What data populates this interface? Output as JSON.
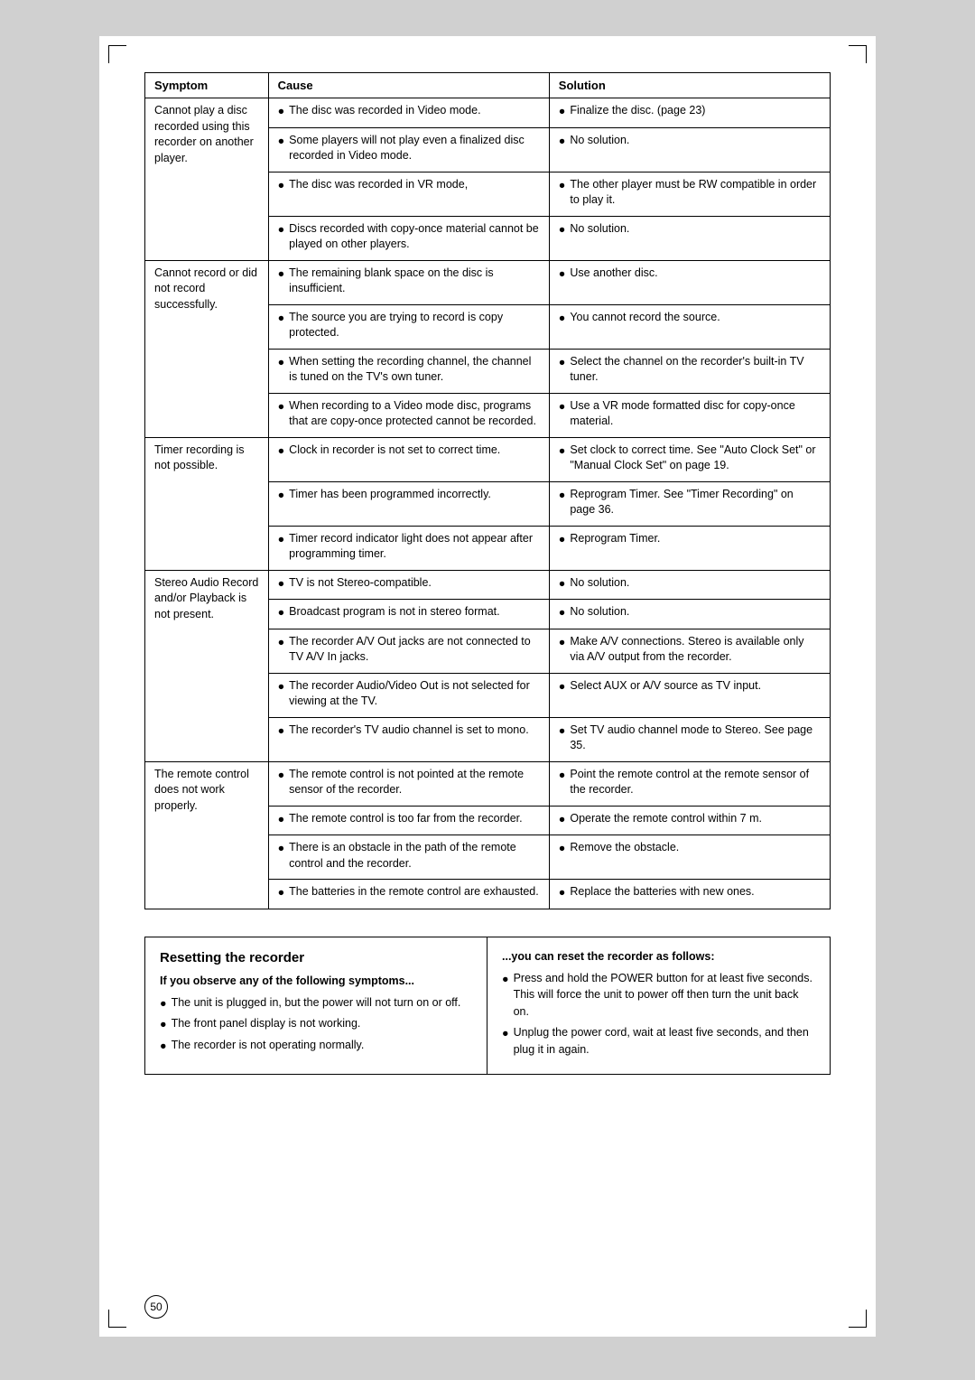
{
  "page": {
    "number": "50",
    "table": {
      "headers": [
        "Symptom",
        "Cause",
        "Solution"
      ],
      "rows": [
        {
          "symptom": "Cannot play a disc recorded using this recorder on another player.",
          "causes": [
            "The disc was recorded in Video mode.",
            "Some players will not play even a finalized disc recorded in Video mode.",
            "The disc was recorded in VR mode,",
            "Discs recorded with copy-once material cannot be played on other players."
          ],
          "solutions": [
            "Finalize the disc. (page 23)",
            "No solution.",
            "The other player must be RW compatible in order to play it.",
            "No solution."
          ]
        },
        {
          "symptom": "Cannot record or did not record successfully.",
          "causes": [
            "The remaining blank space on the disc is insufficient.",
            "The source you are trying to record is copy protected.",
            "When setting the recording channel, the channel is tuned on the TV's own tuner.",
            "When recording to a Video mode disc, programs that are copy-once protected cannot be recorded."
          ],
          "solutions": [
            "Use another disc.",
            "You cannot record the source.",
            "Select the channel on the recorder's built-in TV tuner.",
            "Use a VR mode formatted disc for copy-once material."
          ]
        },
        {
          "symptom": "Timer recording is not possible.",
          "causes": [
            "Clock in recorder is not set to correct time.",
            "Timer has been programmed incorrectly.",
            "Timer record indicator light does not appear after programming timer."
          ],
          "solutions": [
            "Set clock to correct time. See \"Auto Clock Set\" or \"Manual Clock Set\" on page 19.",
            "Reprogram Timer. See \"Timer Recording\" on page 36.",
            "Reprogram Timer."
          ]
        },
        {
          "symptom": "Stereo Audio Record and/or Playback is not present.",
          "causes": [
            "TV is not Stereo-compatible.",
            "Broadcast program is not in stereo format.",
            "The recorder A/V Out jacks are not connected to TV A/V In jacks.",
            "The recorder Audio/Video Out is not selected for viewing at the TV.",
            "The recorder's TV audio channel is set to mono."
          ],
          "solutions": [
            "No solution.",
            "No solution.",
            "Make A/V connections. Stereo is available only via A/V output from the recorder.",
            "Select AUX or A/V source as TV input.",
            "Set TV audio channel mode to Stereo. See page 35."
          ]
        },
        {
          "symptom": "The remote control does not work properly.",
          "causes": [
            "The remote control is not pointed at the remote sensor of the recorder.",
            "The remote control is too far from the recorder.",
            "There is an obstacle in the path of the remote control and the recorder.",
            "The batteries in the remote control are exhausted."
          ],
          "solutions": [
            "Point the remote control at the remote sensor of the recorder.",
            "Operate the remote control within 7 m.",
            "Remove the obstacle.",
            "Replace the batteries with new ones."
          ]
        }
      ]
    },
    "reset": {
      "title": "Resetting the recorder",
      "left_subtitle": "If you observe any of the following symptoms...",
      "left_bullets": [
        "The unit is plugged in, but the power will not turn on or off.",
        "The front panel display is not working.",
        "The recorder is not operating normally."
      ],
      "right_subtitle": "...you can reset the recorder as follows:",
      "right_bullets": [
        "Press and hold the POWER button for at least five seconds. This will force the unit to power off then turn the unit back on.",
        "Unplug the power cord, wait at least five seconds, and then plug it in again."
      ]
    }
  }
}
